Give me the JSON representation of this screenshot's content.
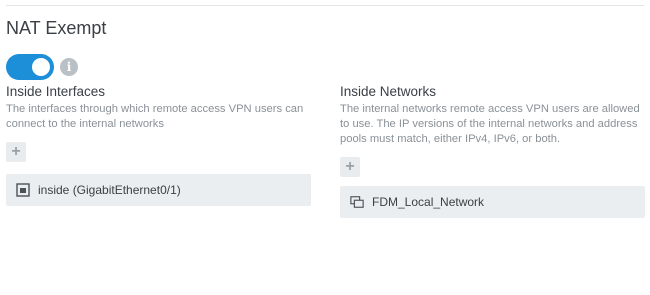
{
  "section": {
    "title": "NAT Exempt"
  },
  "toggle": {
    "state": "on",
    "icon": "info-icon",
    "info_glyph": "i"
  },
  "inside_interfaces": {
    "heading": "Inside Interfaces",
    "description": "The interfaces through which remote access VPN users can connect to the internal networks",
    "add_label": "+",
    "items": [
      {
        "label": "inside (GigabitEthernet0/1)",
        "icon": "interface-icon"
      }
    ]
  },
  "inside_networks": {
    "heading": "Inside Networks",
    "description": "The internal networks remote access VPN users are allowed to use. The IP versions of the internal networks and address pools must match, either IPv4, IPv6, or both.",
    "add_label": "+",
    "items": [
      {
        "label": "FDM_Local_Network",
        "icon": "network-object-icon"
      }
    ]
  },
  "colors": {
    "accent": "#1d8ed8",
    "chip_bg": "#ebeef0",
    "muted_text": "#8a9197"
  }
}
